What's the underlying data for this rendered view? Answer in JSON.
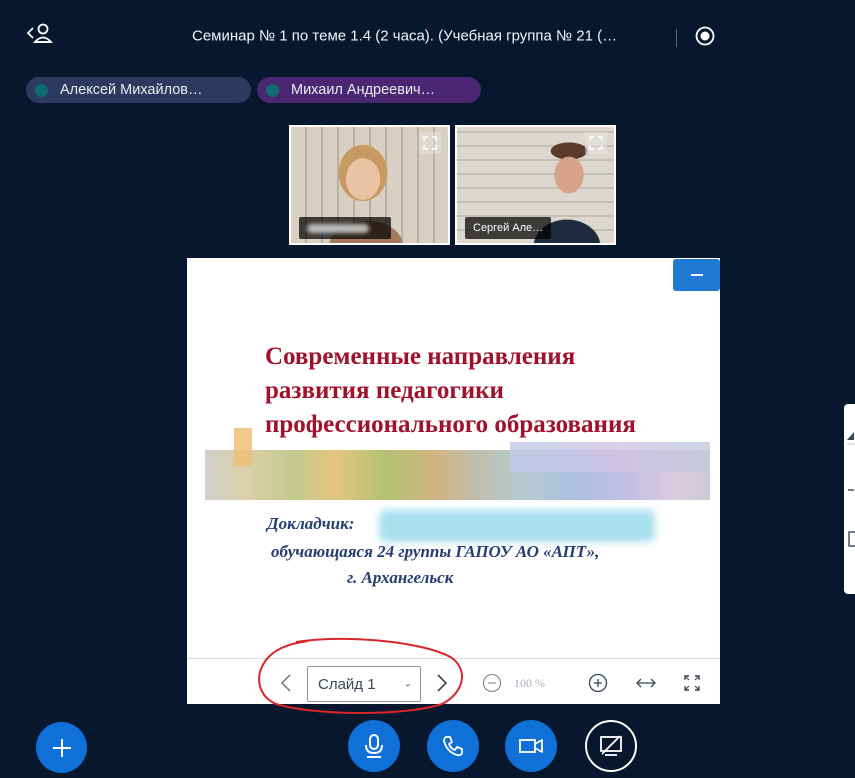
{
  "header": {
    "title": "Семинар № 1 по теме 1.4 (2 часа). (Учебная группа № 21 (…"
  },
  "talkers": [
    {
      "label": "Алексей Михайлов…"
    },
    {
      "label": "Михаил Андреевич…"
    }
  ],
  "videos": [
    {
      "name": ""
    },
    {
      "name": "Сергей Але…"
    }
  ],
  "slide": {
    "title_lines": [
      "Современные направления",
      "развития педагогики",
      "профессионального образования"
    ],
    "reporter_label": "Докладчик:",
    "group_line": "обучающаяся 24 группы ГАПОУ АО «АПТ»,",
    "city_line": "г. Архангельск",
    "title_color": "#a1112c",
    "body_color": "#243d74"
  },
  "presentation_toolbar": {
    "slide_select_value": "Слайд 1",
    "zoom_value": "100 %"
  },
  "colors": {
    "background": "#06172e",
    "accent": "#0f70d7",
    "talker_1_bg": "#2c3a60",
    "talker_2_bg": "#4b2673",
    "annotation_red": "#d9262b"
  },
  "icons": {
    "user_list": "users-icon",
    "record": "record-icon",
    "expand": "expand-icon",
    "minimize": "minimize-icon",
    "prev": "chevron-left-icon",
    "next": "chevron-right-icon",
    "zoom_out": "zoom-out-icon",
    "zoom_in": "zoom-in-icon",
    "fit_width": "fit-width-icon",
    "fullscreen": "fullscreen-icon",
    "actions": "plus-icon",
    "mic": "microphone-icon",
    "phone": "phone-icon",
    "camera": "camera-icon",
    "screen_share": "screen-share-off-icon"
  }
}
